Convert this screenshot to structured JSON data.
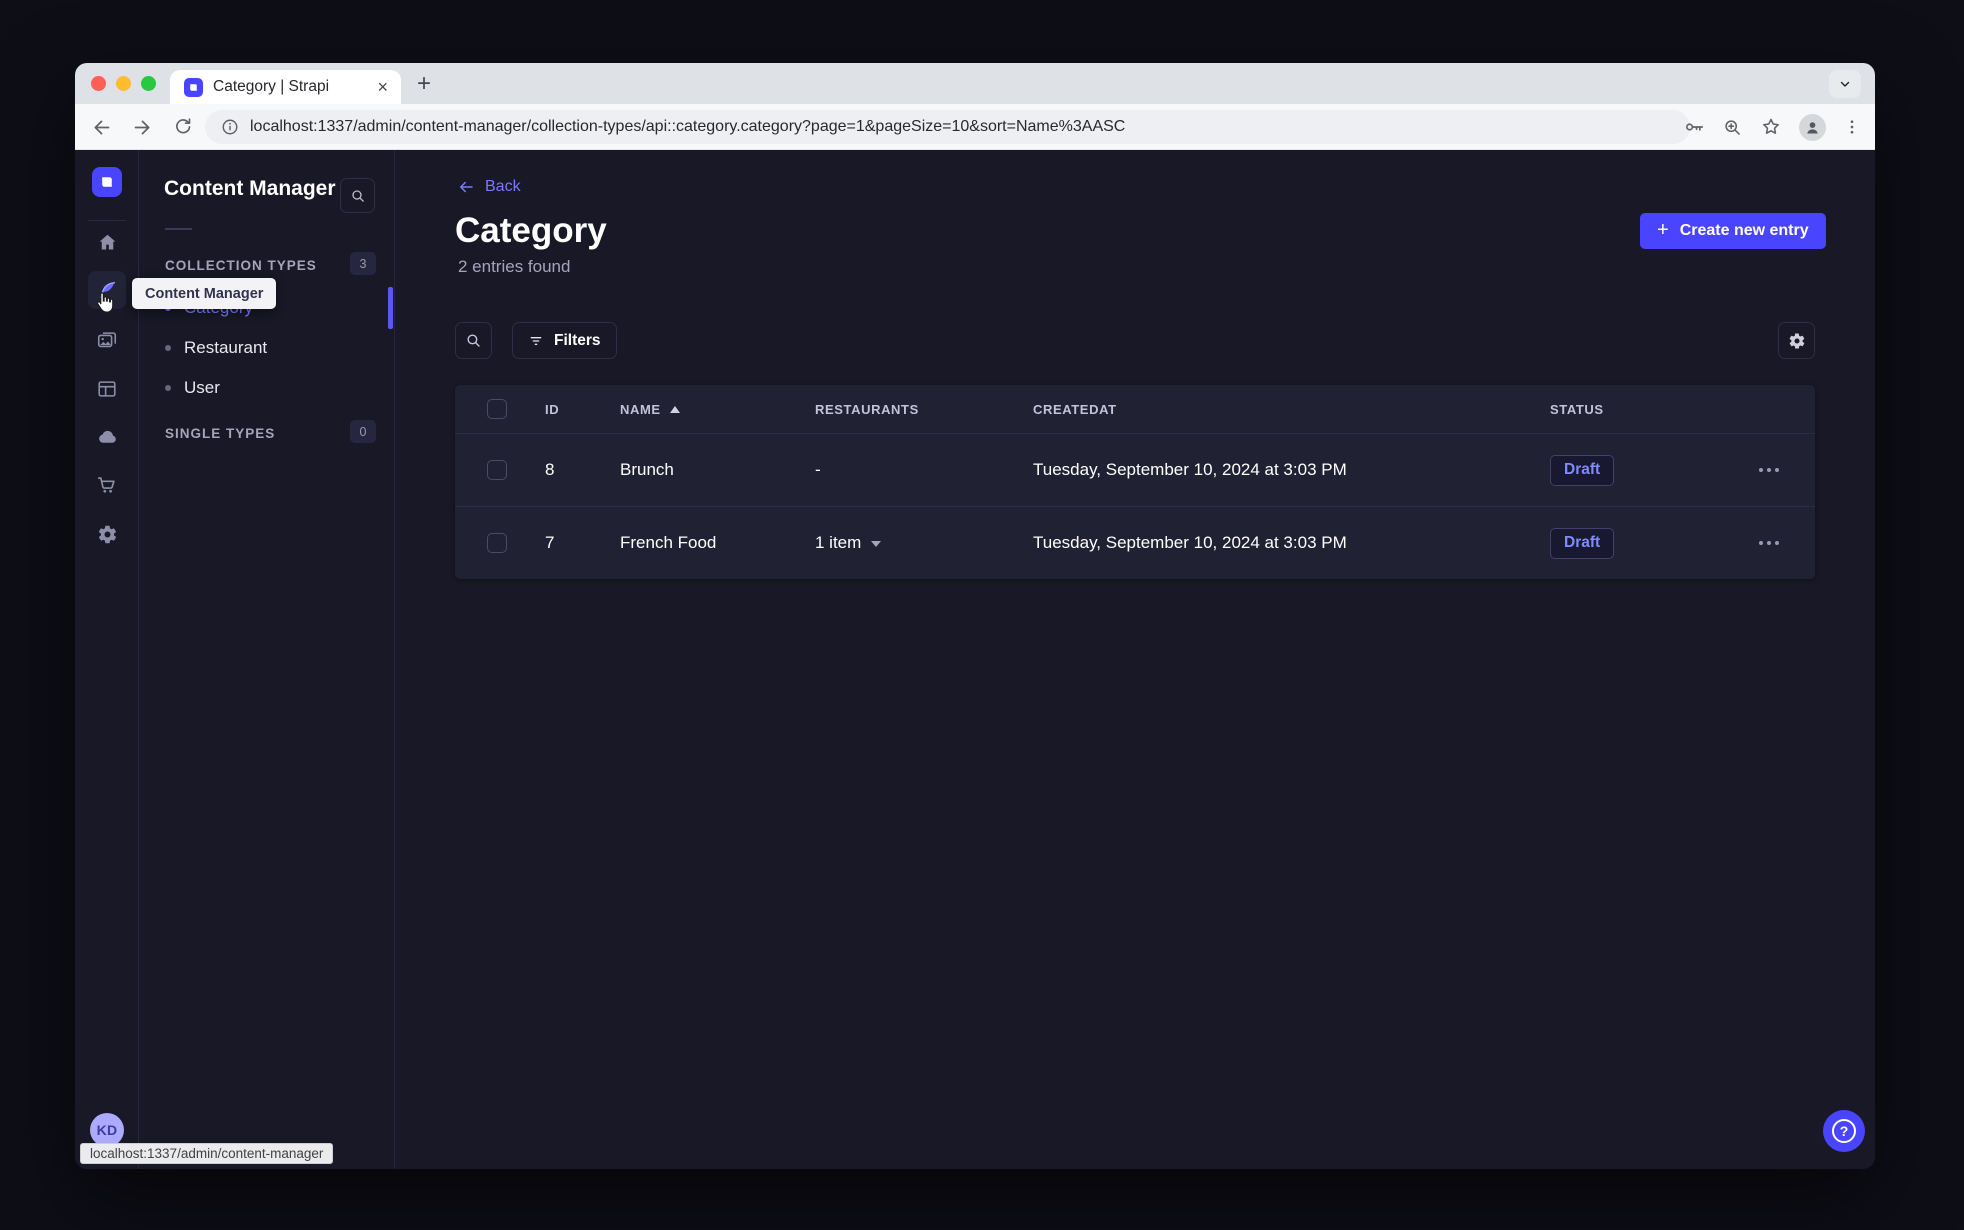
{
  "browser": {
    "tab_title": "Category | Strapi",
    "url": "localhost:1337/admin/content-manager/collection-types/api::category.category?page=1&pageSize=10&sort=Name%3AASC",
    "status_bar_text": "localhost:1337/admin/content-manager"
  },
  "icons": {
    "plus": "+",
    "close": "×"
  },
  "nav_rail": {
    "items": [
      "home",
      "content-manager",
      "media-library",
      "content-type-builder",
      "deploy",
      "marketplace",
      "settings"
    ],
    "active_item": "content-manager",
    "avatar_initials": "KD"
  },
  "subnav": {
    "title": "Content Manager",
    "collection_section": {
      "label": "COLLECTION TYPES",
      "badge": "3"
    },
    "items": [
      {
        "label": "Category",
        "active": true
      },
      {
        "label": "Restaurant",
        "active": false
      },
      {
        "label": "User",
        "active": false
      }
    ],
    "single_section": {
      "label": "SINGLE TYPES",
      "badge": "0"
    }
  },
  "tooltip": {
    "text": "Content Manager"
  },
  "main": {
    "back_label": "Back",
    "title": "Category",
    "subtitle": "2 entries found",
    "create_button_label": "Create new entry",
    "filters_button_label": "Filters",
    "table": {
      "sort": {
        "column": "NAME",
        "direction": "asc"
      },
      "headers": {
        "id": "ID",
        "name": "NAME",
        "restaurants": "RESTAURANTS",
        "createdat": "CREATEDAT",
        "status": "STATUS"
      },
      "rows": [
        {
          "id": "8",
          "name": "Brunch",
          "restaurants": "-",
          "createdat": "Tuesday, September 10, 2024 at 3:03 PM",
          "status": "Draft"
        },
        {
          "id": "7",
          "name": "French Food",
          "restaurants": "1 item",
          "createdat": "Tuesday, September 10, 2024 at 3:03 PM",
          "status": "Draft"
        }
      ]
    }
  },
  "colors": {
    "primary": "#4945ff",
    "primary_light": "#7b79ff",
    "app_bg": "#181826",
    "card_bg": "#212134",
    "border": "#32324d",
    "muted": "#a5a5ba"
  }
}
